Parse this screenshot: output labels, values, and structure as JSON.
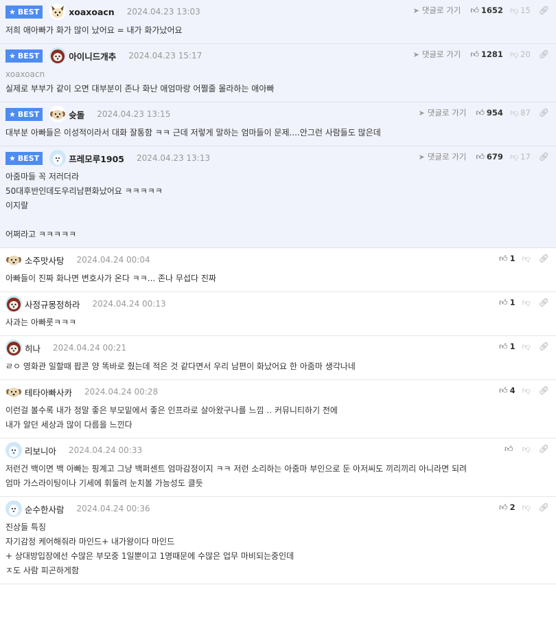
{
  "colors": {
    "best_badge": "#4d8cf0",
    "best_bg": "#f0f3fb",
    "border": "#e6e6e6"
  },
  "labels": {
    "best": "BEST",
    "reply": "댓글로 가기"
  },
  "best": [
    {
      "nick": "xoaxoacn",
      "date": "2024.04.23 13:03",
      "up": "1652",
      "down": "15",
      "avatar": "fox",
      "mention": "",
      "lines": [
        "저희 애아빠가 화가 많이 났어요 = 내가 화가났어요"
      ]
    },
    {
      "nick": "아이니드개추",
      "date": "2024.04.23 15:17",
      "up": "1281",
      "down": "20",
      "avatar": "dog-red",
      "mention": "xoaxoacn",
      "lines": [
        "실제로 부부가 같이 오면 대부분이 존나 화난 애엄마랑 어쩔줄 몰라하는 애아빠"
      ]
    },
    {
      "nick": "슛돌",
      "date": "2024.04.23 13:15",
      "up": "954",
      "down": "87",
      "avatar": "puppy",
      "mention": "",
      "lines": [
        "대부분 아빠들은 이성적이라서 대화 잘통함 ㅋㅋ 근데 저렇게 말하는 엄마들이 문제....안그런 사람들도 많은데"
      ]
    },
    {
      "nick": "프레모루1905",
      "date": "2024.04.23 13:13",
      "up": "679",
      "down": "17",
      "avatar": "blue",
      "mention": "",
      "lines": [
        "아줌마들 꼭 저러더라",
        "50대후반인데도우리남편화났어요 ㅋㅋㅋㅋㅋ",
        "이지랄",
        "",
        "어쩌라고 ㅋㅋㅋㅋㅋ"
      ]
    }
  ],
  "normal": [
    {
      "nick": "소주맛사탕",
      "date": "2024.04.24 00:04",
      "up": "1",
      "avatar": "puppy",
      "lines": [
        "아빠들이 진짜 화나면 변호사가 온다 ㅋㅋ... 존나 무섭다 진짜"
      ]
    },
    {
      "nick": "사정규몽정하라",
      "date": "2024.04.24 00:13",
      "up": "1",
      "avatar": "dog-red",
      "lines": [
        "사과는 아빠룻ㅋㅋㅋ"
      ]
    },
    {
      "nick": "히나",
      "date": "2024.04.24 00:21",
      "up": "1",
      "avatar": "dog-red",
      "lines": [
        "ㄹㅇ 영화관 일할때 팝콘 양 똑바로 줬는데 적은 것 같다면서 우리 남편이 화났어요 한 아줌마 생각나네"
      ]
    },
    {
      "nick": "테타아빠사카",
      "date": "2024.04.24 00:28",
      "up": "4",
      "avatar": "puppy",
      "lines": [
        "이런걸 볼수록 내가 정말 좋은 부모밑에서 좋은 인프라로 살아왔구나를 느낌 .. 커뮤니티하기 전에",
        "내가 알던 세상과 많이 다름을 느낀다"
      ]
    },
    {
      "nick": "리보니아",
      "date": "2024.04.24 00:33",
      "up": "",
      "avatar": "blue",
      "lines": [
        "저런건 백이면 백 아빠는 핑계고 그냥 백퍼센트 엄마감정이지 ㅋㅋ 저런 소리하는 아줌마 부인으로 둔 아저씨도 끼리끼리 아니라면 되려",
        "엄마 가스라이팅이나 기세에 휘둘려 눈치볼 가능성도 클듯"
      ]
    },
    {
      "nick": "순수한사람",
      "date": "2024.04.24 00:36",
      "up": "2",
      "avatar": "blue",
      "lines": [
        "진상들 특징",
        "자기감정 케어해줘라 마인드+ 내가왕이다 마인드",
        "+ 상대방입장에선 수많은 부모중 1일뿐이고 1명때문에 수많은 업무 마비되는중인데",
        "ㅈ도 사람 피곤하게함"
      ]
    }
  ]
}
